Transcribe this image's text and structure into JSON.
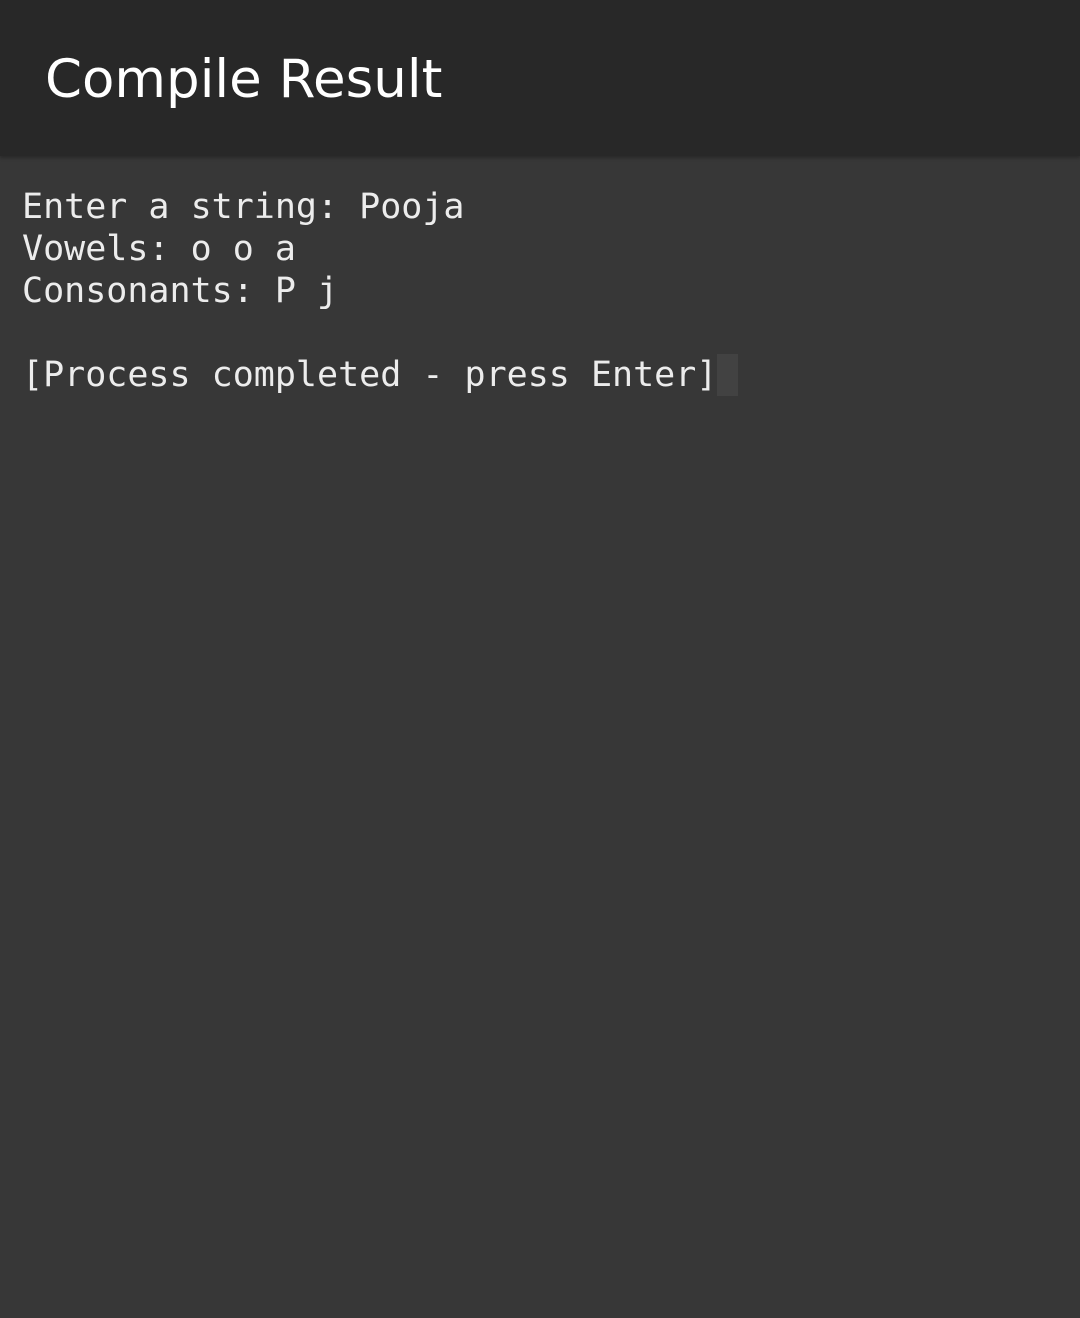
{
  "header": {
    "title": "Compile Result"
  },
  "terminal": {
    "lines": [
      "Enter a string: Pooja",
      "Vowels: o o a",
      "Consonants: P j",
      "",
      "[Process completed - press Enter]"
    ]
  },
  "colors": {
    "app_bar": "#282828",
    "background": "#373737",
    "text": "#ececec",
    "cursor": "#424242"
  }
}
